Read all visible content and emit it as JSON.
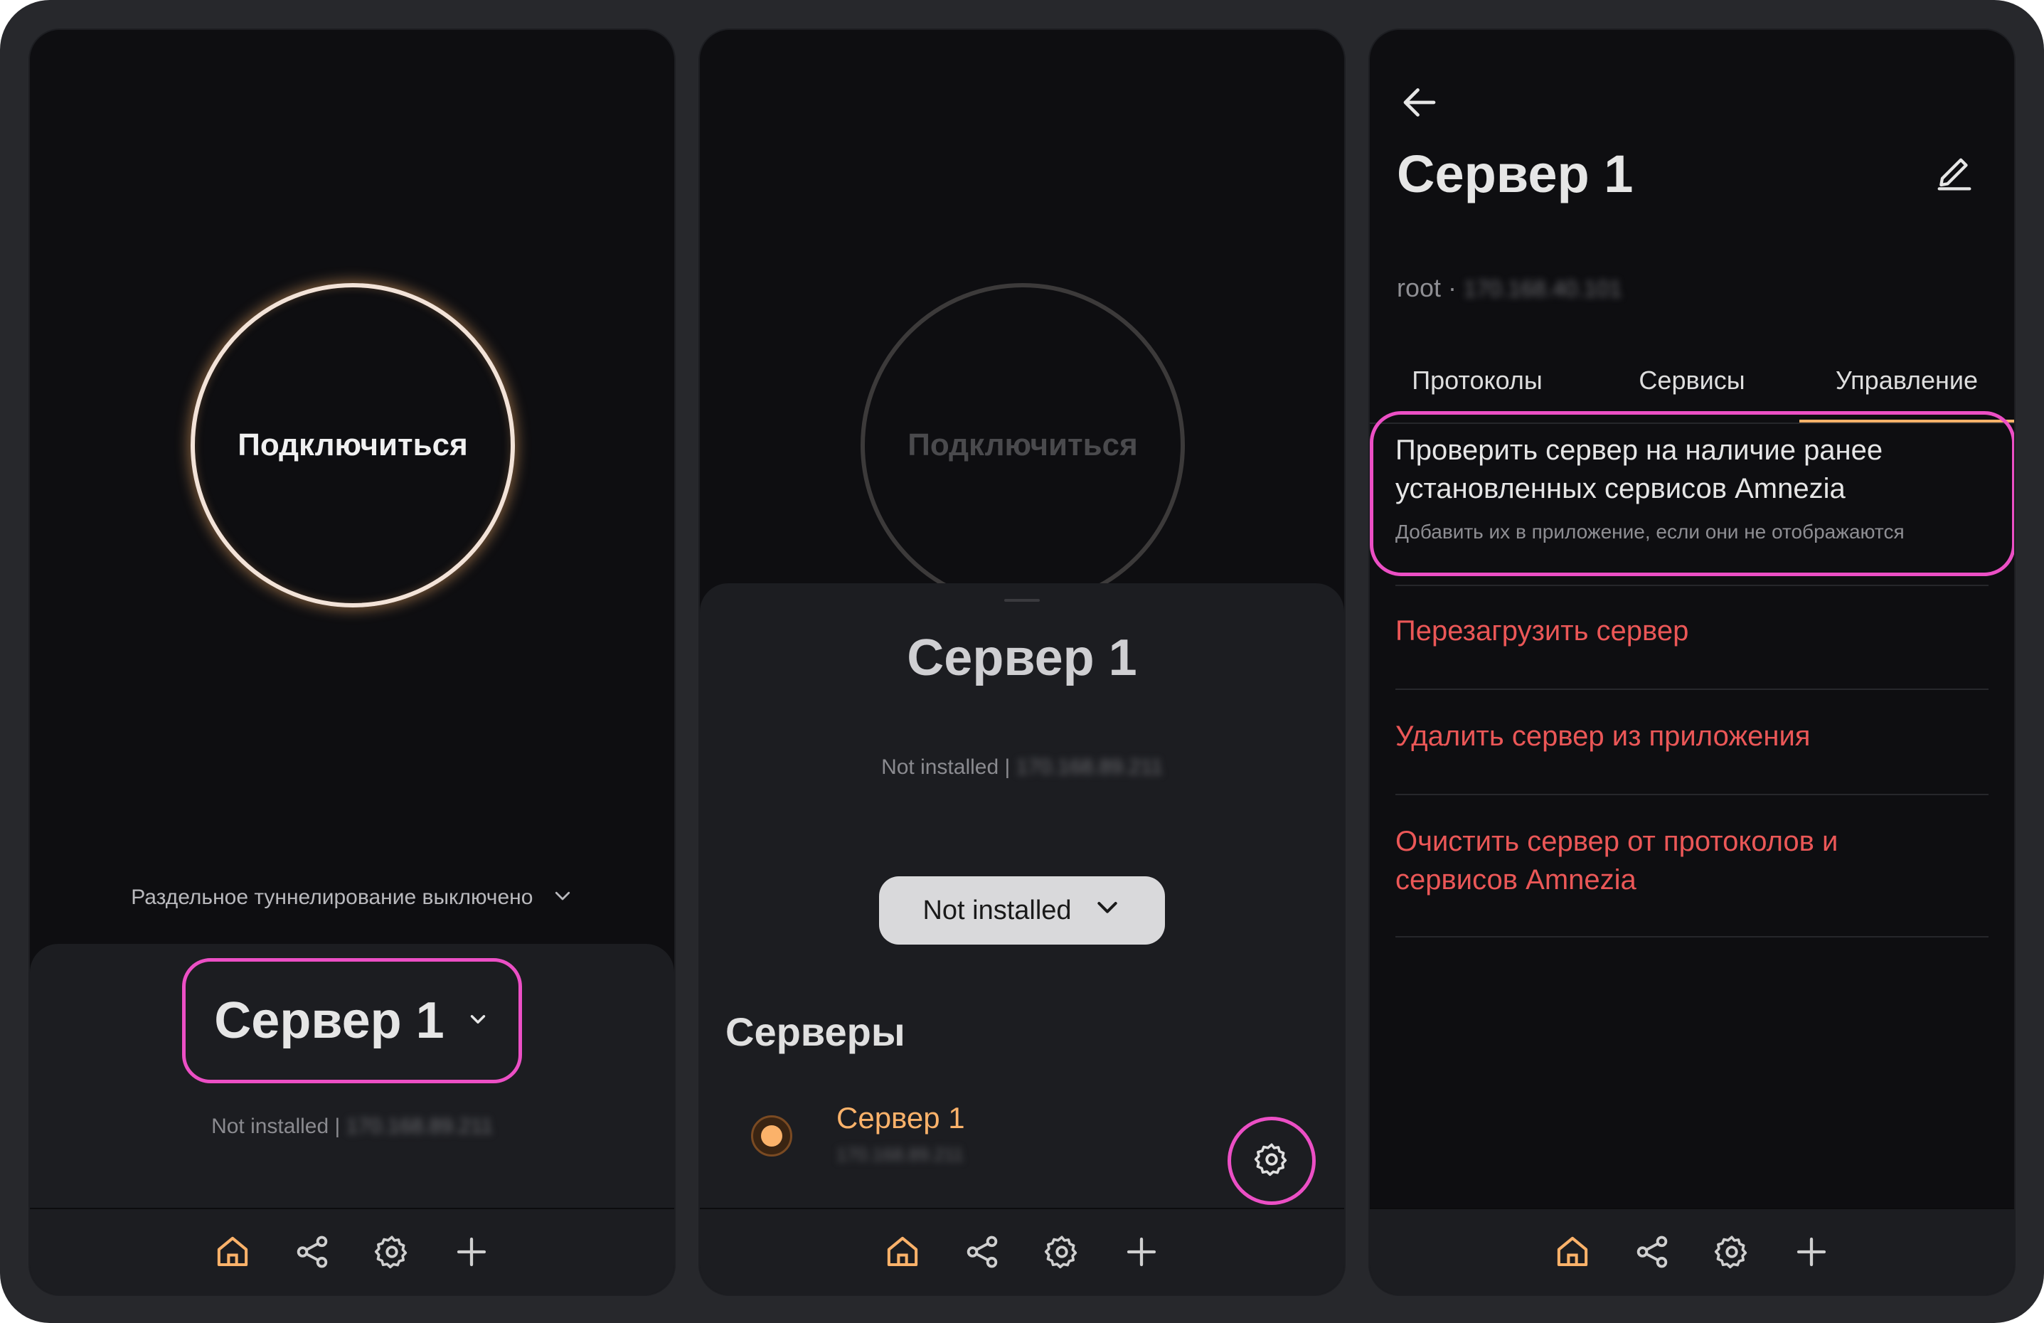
{
  "colors": {
    "accent": "#fbb26a",
    "highlight": "#ec4fc5",
    "danger": "#eb5757",
    "background": "#0e0e11",
    "sheet": "#1c1d21"
  },
  "navbar": {
    "items": [
      {
        "icon": "home-icon",
        "active": true
      },
      {
        "icon": "share-icon",
        "active": false
      },
      {
        "icon": "gear-icon",
        "active": false
      },
      {
        "icon": "plus-icon",
        "active": false
      }
    ]
  },
  "panel1": {
    "connect_label": "Подключиться",
    "split_tunneling": "Раздельное туннелирование выключено",
    "server_name": "Сервер 1",
    "status_prefix": "Not installed |",
    "status_ip": "170.168.89.211"
  },
  "panel2": {
    "connect_label": "Подключиться",
    "sheet_title": "Сервер 1",
    "status_prefix": "Not installed |",
    "status_ip": "170.168.89.211",
    "protocol_select": "Not installed",
    "servers_title": "Серверы",
    "server_item": {
      "name": "Сервер 1",
      "ip": "170.168.89.211",
      "selected": true
    }
  },
  "panel3": {
    "title": "Сервер 1",
    "subtitle_user": "root ·",
    "subtitle_ip": "170.168.40.101",
    "tabs": [
      "Протоколы",
      "Сервисы",
      "Управление"
    ],
    "active_tab": "Управление",
    "check_action": {
      "title": "Проверить сервер на наличие ранее установленных сервисов Amnezia",
      "description": "Добавить их в приложение, если они не отображаются"
    },
    "reboot_action": "Перезагрузить сервер",
    "remove_action": "Удалить сервер из приложения",
    "clear_action": "Очистить сервер от протоколов и сервисов Amnezia"
  }
}
